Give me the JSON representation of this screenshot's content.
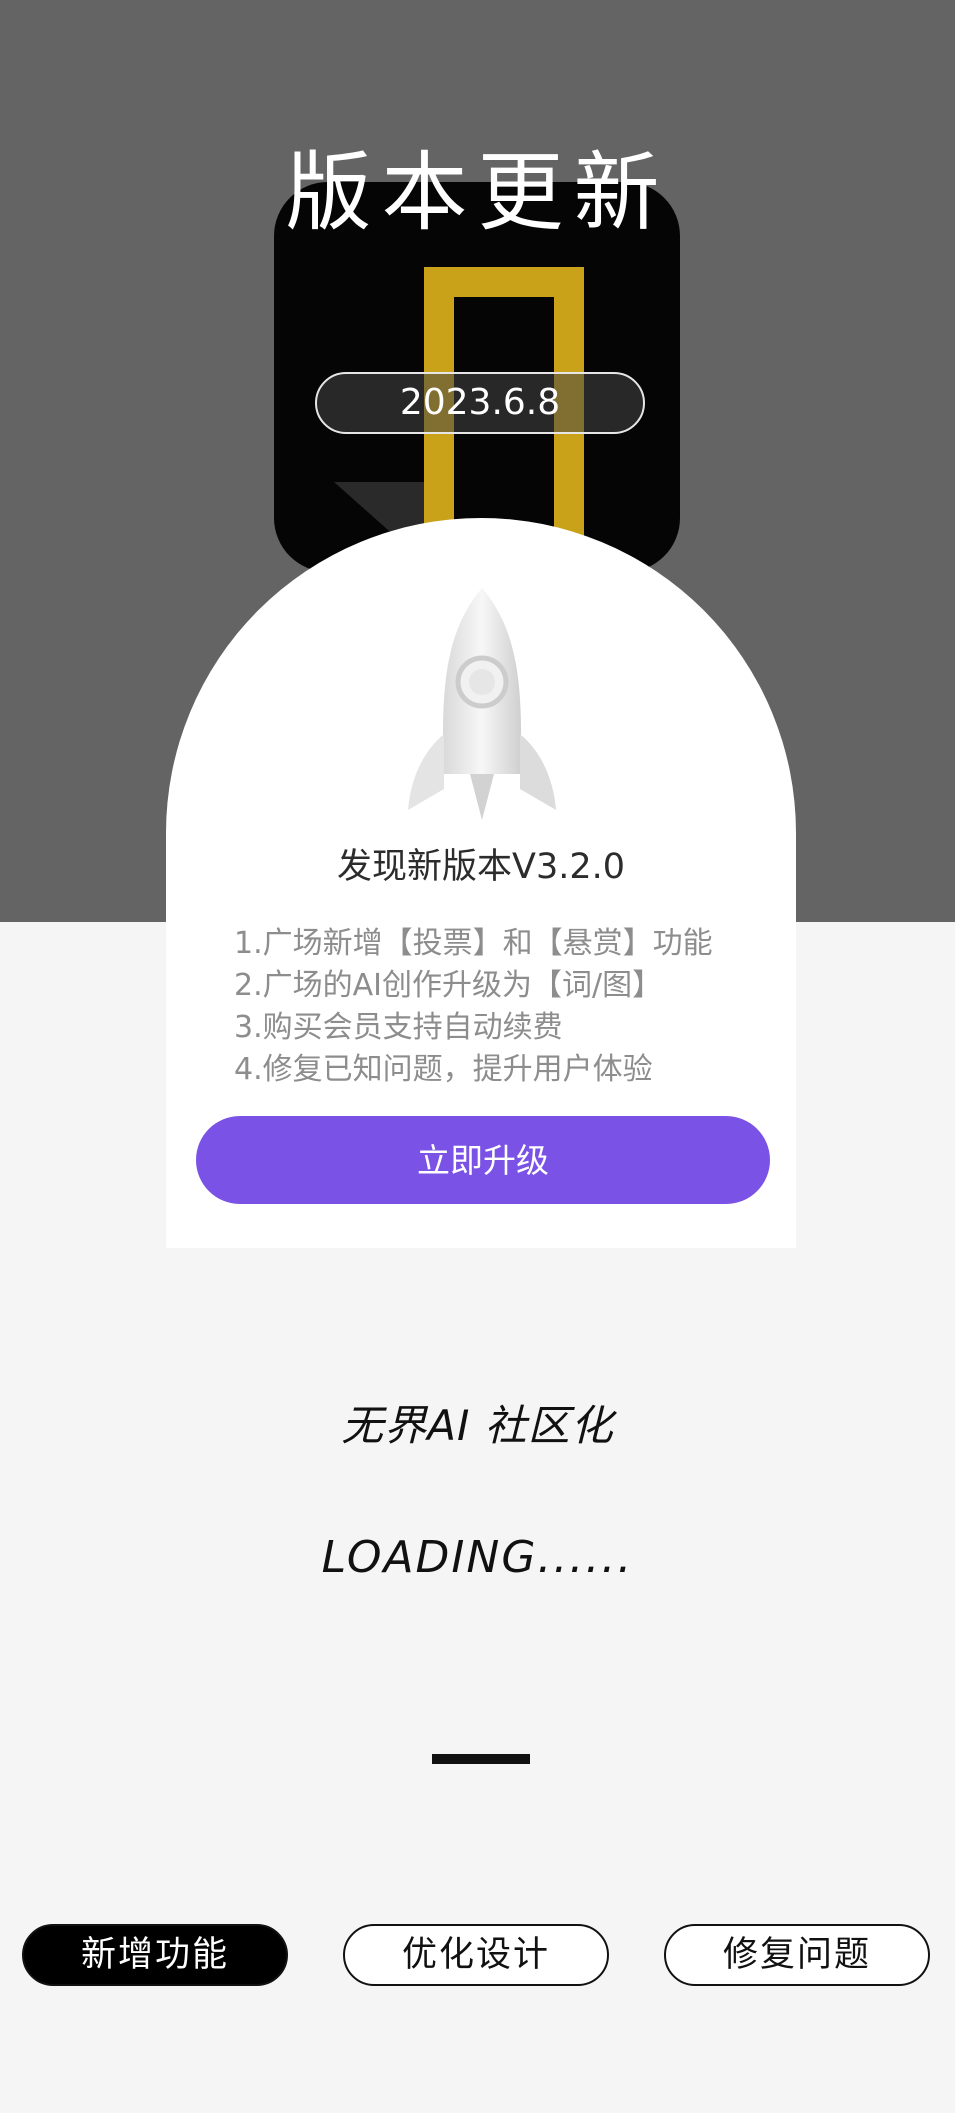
{
  "header": {
    "title": "版本更新",
    "date": "2023.6.8"
  },
  "update_card": {
    "title": "发现新版本V3.2.0",
    "changelog": [
      "1.广场新增【投票】和【悬赏】功能",
      "2.广场的AI创作升级为【词/图】",
      "3.购买会员支持自动续费",
      "4.修复已知问题，提升用户体验"
    ],
    "upgrade_button_label": "立即升级"
  },
  "tagline": "无界AI 社区化",
  "loading": "LOADING......",
  "tabs": [
    {
      "label": "新增功能",
      "active": true
    },
    {
      "label": "优化设计",
      "active": false
    },
    {
      "label": "修复问题",
      "active": false
    }
  ],
  "colors": {
    "top_background": "#646464",
    "page_background": "#f5f5f5",
    "accent_purple": "#7a52e6",
    "logo_gold": "#c9a21a"
  },
  "icons": {
    "app_logo": "wujie-app-logo",
    "rocket": "rocket-icon"
  }
}
